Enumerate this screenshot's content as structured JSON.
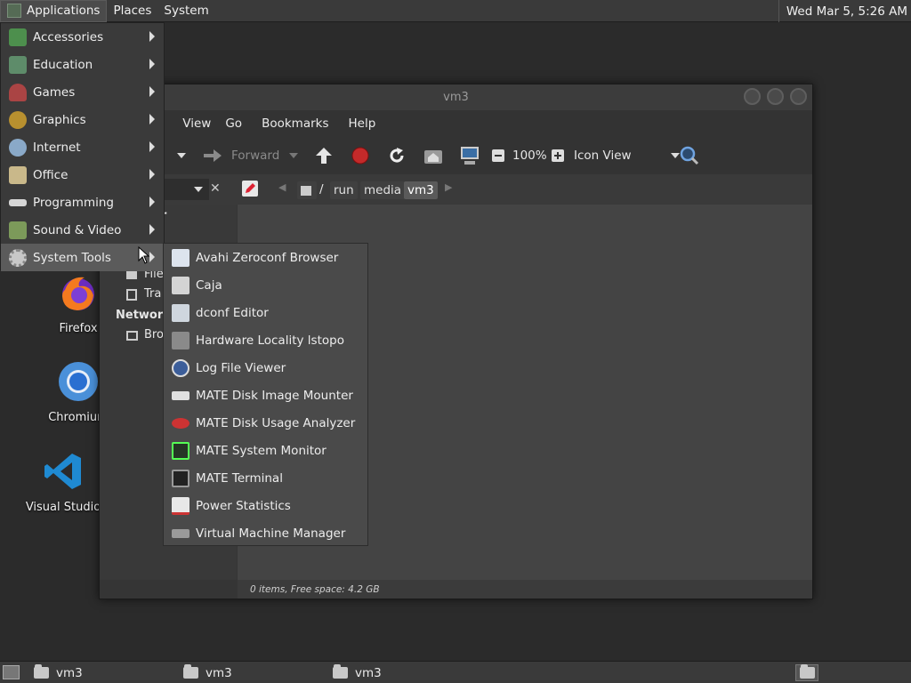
{
  "top_panel": {
    "applications": "Applications",
    "places": "Places",
    "system": "System",
    "clock": "Wed Mar  5,  5:26 AM"
  },
  "desktop_icons": [
    {
      "label": "Firefox",
      "icon": "firefox-icon"
    },
    {
      "label": "Chromium",
      "icon": "chromium-icon"
    },
    {
      "label": "Visual Studio",
      "icon": "vscode-icon"
    }
  ],
  "file_manager": {
    "title": "vm3",
    "menus": [
      "t",
      "View",
      "Go",
      "Bookmarks",
      "Help"
    ],
    "toolbar": {
      "forward": "Forward",
      "zoom": "100%",
      "view_mode": "Icon View"
    },
    "breadcrumbs": [
      "/",
      "run",
      "media",
      "vm3"
    ],
    "sidebar": {
      "partial_1": "er",
      "partial_2": "3",
      "file_system": "File",
      "trash": "Tra",
      "network_header": "Network",
      "browse": "Bro"
    },
    "status": "0 items, Free space: 4.2 GB"
  },
  "apps_menu": {
    "items": [
      {
        "label": "Accessories",
        "icon": "accessories-icon"
      },
      {
        "label": "Education",
        "icon": "education-icon"
      },
      {
        "label": "Games",
        "icon": "games-icon"
      },
      {
        "label": "Graphics",
        "icon": "graphics-icon"
      },
      {
        "label": "Internet",
        "icon": "internet-icon"
      },
      {
        "label": "Office",
        "icon": "office-icon"
      },
      {
        "label": "Programming",
        "icon": "programming-icon"
      },
      {
        "label": "Sound & Video",
        "icon": "sound-video-icon"
      },
      {
        "label": "System Tools",
        "icon": "system-tools-icon"
      }
    ],
    "selected": "System Tools"
  },
  "system_tools_menu": {
    "items": [
      {
        "label": "Avahi Zeroconf Browser",
        "icon": "avahi-icon"
      },
      {
        "label": "Caja",
        "icon": "caja-icon"
      },
      {
        "label": "dconf Editor",
        "icon": "dconf-icon"
      },
      {
        "label": "Hardware Locality lstopo",
        "icon": "lstopo-icon"
      },
      {
        "label": "Log File Viewer",
        "icon": "log-viewer-icon"
      },
      {
        "label": "MATE Disk Image Mounter",
        "icon": "disk-mounter-icon"
      },
      {
        "label": "MATE Disk Usage Analyzer",
        "icon": "disk-usage-icon"
      },
      {
        "label": "MATE System Monitor",
        "icon": "system-monitor-icon"
      },
      {
        "label": "MATE Terminal",
        "icon": "terminal-icon"
      },
      {
        "label": "Power Statistics",
        "icon": "power-stats-icon"
      },
      {
        "label": "Virtual Machine Manager",
        "icon": "vm-manager-icon"
      }
    ]
  },
  "bottom_panel": {
    "tasks": [
      "vm3",
      "vm3",
      "vm3"
    ]
  }
}
